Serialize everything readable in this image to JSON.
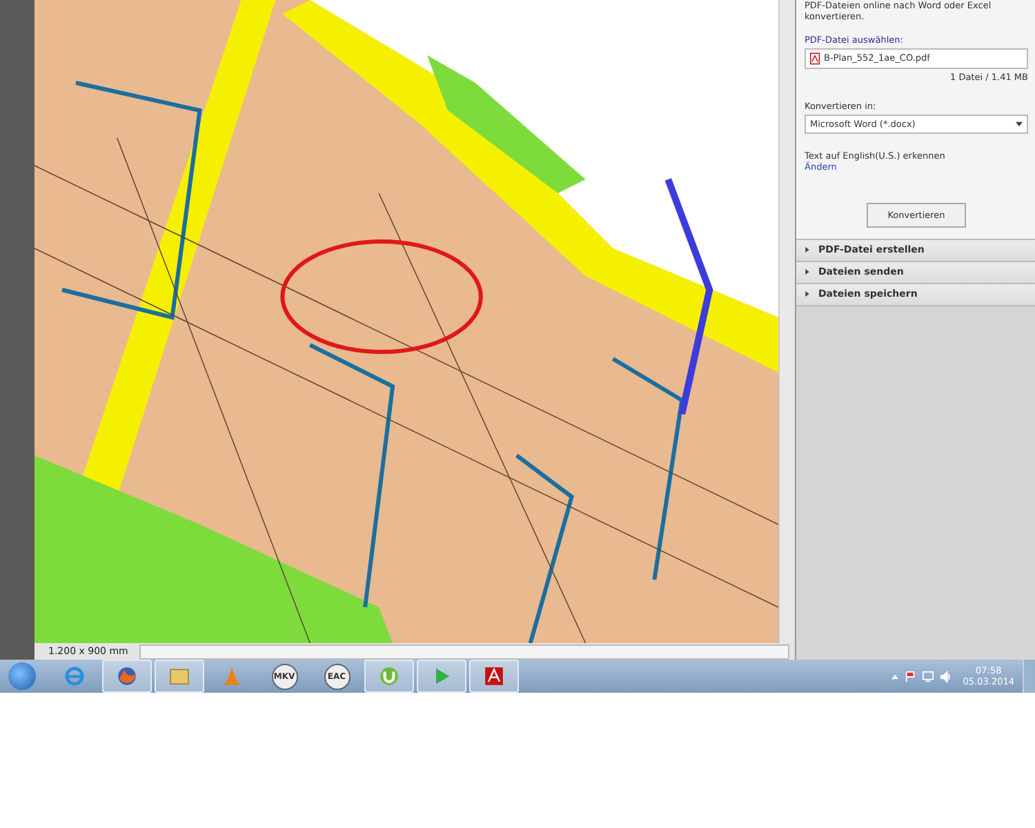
{
  "document": {
    "page_size": "1.200 x 900 mm"
  },
  "panel": {
    "intro": "PDF-Dateien online nach Word oder Excel konvertieren.",
    "select_label": "PDF-Datei auswählen:",
    "file_name": "B-Plan_552_1ae_CO.pdf",
    "file_info": "1 Datei / 1.41 MB",
    "convert_label": "Konvertieren in:",
    "format": "Microsoft Word (*.docx)",
    "ocr_text": "Text auf English(U.S.) erkennen",
    "change_link": "Ändern",
    "convert_button": "Konvertieren",
    "sections": [
      {
        "label": "PDF-Datei erstellen",
        "expanded": false
      },
      {
        "label": "Dateien senden",
        "expanded": false
      },
      {
        "label": "Dateien speichern",
        "expanded": false
      }
    ]
  },
  "taskbar": {
    "apps": [
      {
        "kind": "ie",
        "running": false
      },
      {
        "kind": "firefox",
        "running": true
      },
      {
        "kind": "explorer",
        "running": true
      },
      {
        "kind": "vlc",
        "running": false
      },
      {
        "kind": "badge",
        "label": "MKV",
        "running": false
      },
      {
        "kind": "badge",
        "label": "EAC",
        "running": false
      },
      {
        "kind": "utorrent",
        "running": true
      },
      {
        "kind": "player",
        "running": true
      },
      {
        "kind": "acrobat",
        "running": true
      }
    ],
    "clock": {
      "time": "07:58",
      "date": "05.03.2014"
    }
  }
}
